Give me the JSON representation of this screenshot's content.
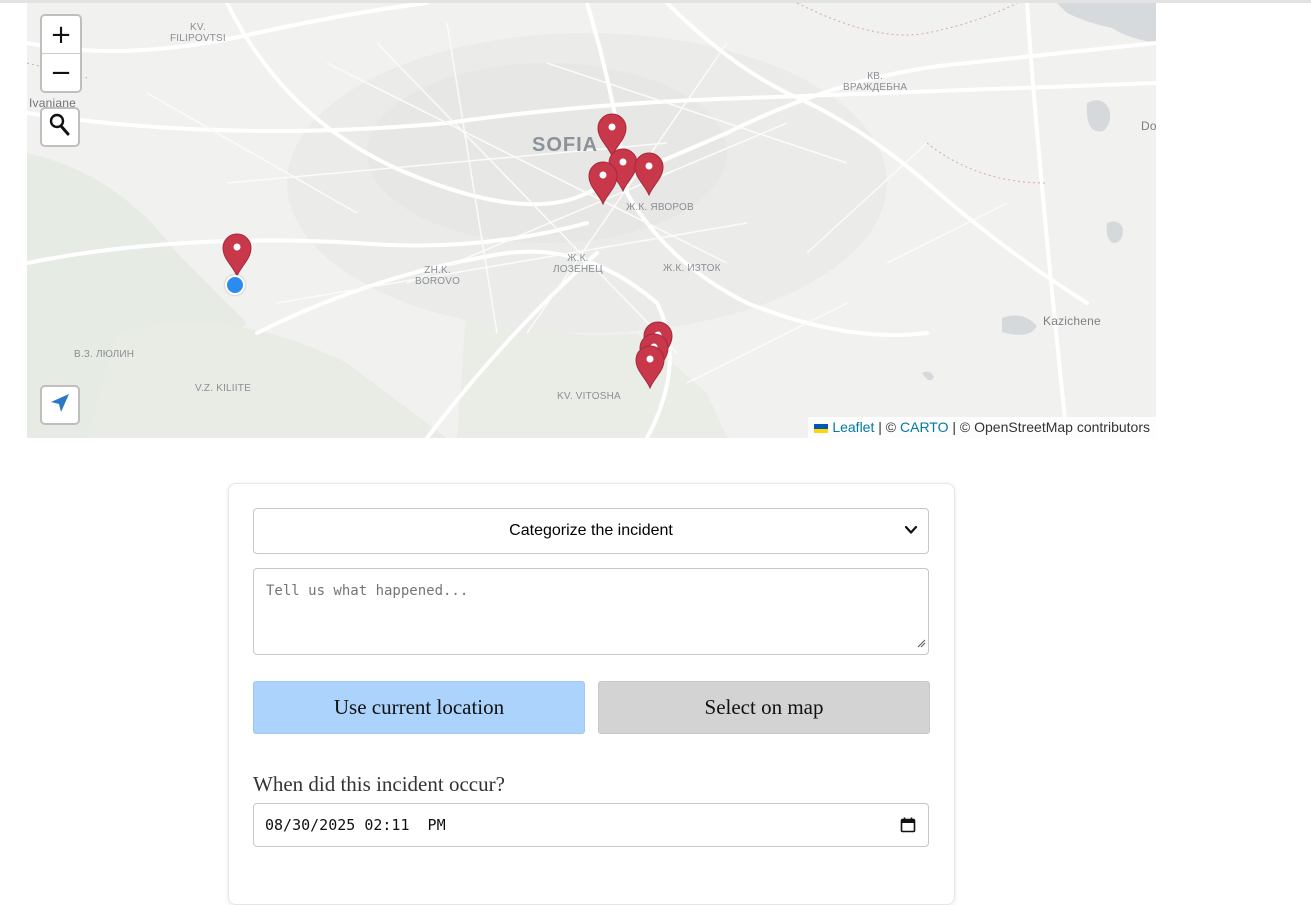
{
  "map": {
    "controls": {
      "zoom_in": "+",
      "zoom_out": "−"
    },
    "labels": {
      "sofia": "SOFIA",
      "filipovtsi": "KV.\nFILIPOVTSI",
      "ivanjane": "Ivanjane",
      "vrazhdebna": "КВ.\nВРАЖДЕБНА",
      "do": "Do",
      "yavorov": "Ж.К. ЯВОРОВ",
      "lozenets": "Ж.К.\nЛОЗЕНЕЦ",
      "iztok": "Ж.К. ИЗТОК",
      "borovo": "ZH.K.\nBOROVO",
      "lyulin": "В.З. ЛЮЛИН",
      "kiliite": "V.Z. KILIITE",
      "vitosha": "KV. VITOSHA",
      "kazichene": "Kazichene"
    },
    "attribution": {
      "leaflet": "Leaflet",
      "sep1": " | © ",
      "carto": "CARTO",
      "sep2": " | © OpenStreetMap contributors"
    },
    "marker_color": "#c8374a",
    "location_dot_color": "#2b8cee"
  },
  "form": {
    "category_select": "Categorize the incident",
    "description_placeholder": "Tell us what happened...",
    "use_location_button": "Use current location",
    "select_on_map_button": "Select on map",
    "when_label": "When did this incident occur?",
    "datetime_value": "08/30/2025 02:11  PM"
  }
}
